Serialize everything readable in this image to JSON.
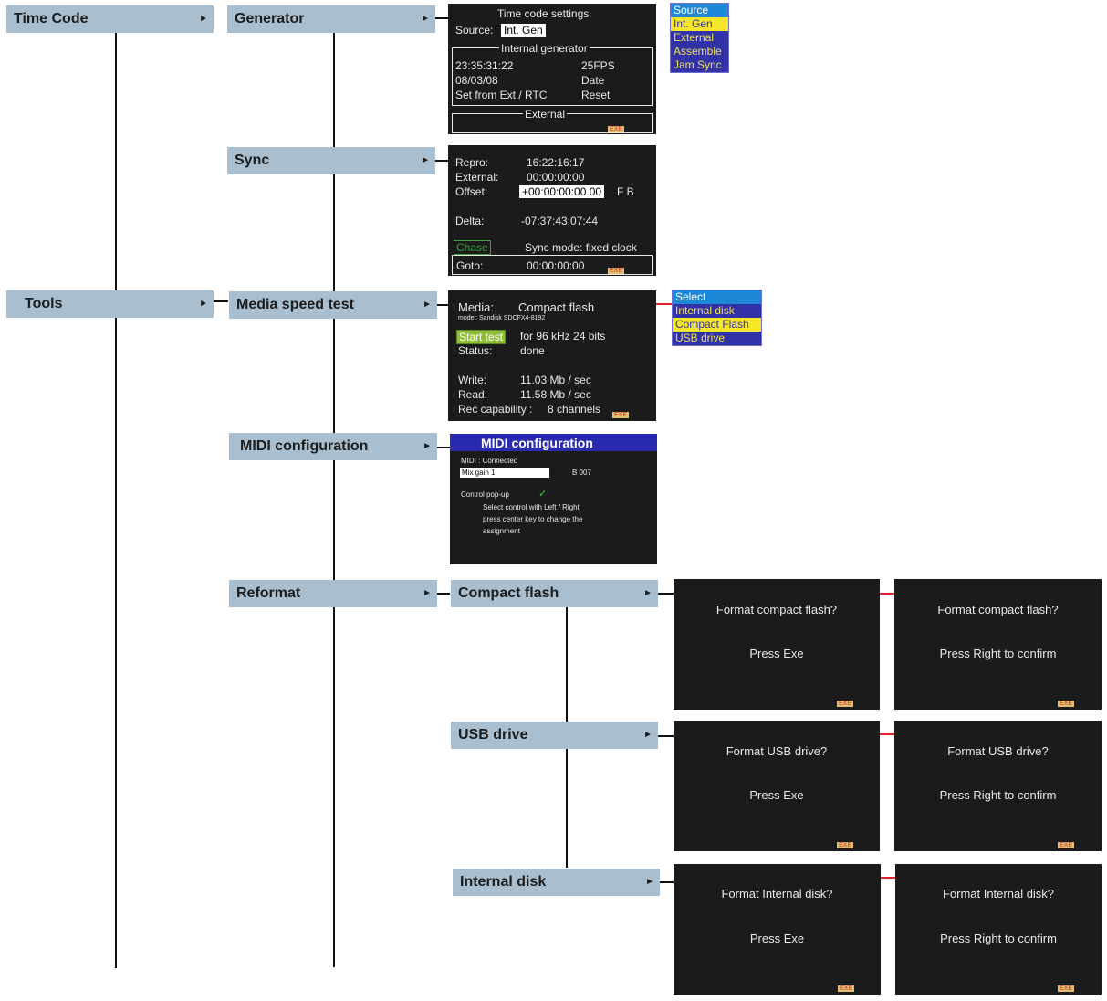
{
  "menus": {
    "time_code": "Time Code",
    "tools": "Tools",
    "generator": "Generator",
    "sync": "Sync",
    "media_speed_test": "Media speed test",
    "midi_configuration": "MIDI configuration",
    "reformat": "Reformat",
    "compact_flash": "Compact flash",
    "usb_drive": "USB drive",
    "internal_disk": "Internal disk",
    "arrow": "►"
  },
  "generator_screen": {
    "title": "Time code settings",
    "source_label": "Source:",
    "source_value": "Int. Gen",
    "internal_generator": "Internal generator",
    "time": "23:35:31:22",
    "fps": "25FPS",
    "date": "08/03/08",
    "date_label": "Date",
    "set_from": "Set from Ext / RTC",
    "reset": "Reset",
    "external": "External",
    "exe": "EXE"
  },
  "source_popup": [
    "Source",
    "Int. Gen",
    "External",
    "Assemble",
    "Jam Sync"
  ],
  "sync_screen": {
    "repro_label": "Repro:",
    "repro_value": "16:22:16:17",
    "external_label": "External:",
    "external_value": "00:00:00:00",
    "offset_label": "Offset:",
    "offset_value": "+00:00:00:00.00",
    "offset_fb": "F B",
    "delta_label": "Delta:",
    "delta_value": "-07:37:43:07:44",
    "chase": "Chase",
    "sync_mode": "Sync mode: fixed clock",
    "goto_label": "Goto:",
    "goto_value": "00:00:00:00",
    "exe": "EXE"
  },
  "media_screen": {
    "media_label": "Media:",
    "media_value": "Compact flash",
    "model": "model: Sandisk SDCFX4-8192",
    "start_test": "Start test",
    "start_desc": "for 96 kHz 24 bits",
    "status_label": "Status:",
    "status_value": "done",
    "write_label": "Write:",
    "write_value": "11.03 Mb / sec",
    "read_label": "Read:",
    "read_value": "11.58 Mb / sec",
    "rec_label": "Rec capability :",
    "rec_value": "8 channels",
    "exe": "EXE"
  },
  "select_popup": [
    "Select",
    "Internal disk",
    "Compact Flash",
    "USB drive"
  ],
  "midi_screen": {
    "title": "MIDI configuration",
    "connected": "MIDI : Connected",
    "field": "Mix gain 1",
    "code": "B 007",
    "control_popup": "Control pop-up",
    "check": "✓",
    "hint1": "Select control with Left / Right",
    "hint2": "press center key to change the",
    "hint3": "assignment"
  },
  "confirm_screens": [
    {
      "q": "Format compact flash?",
      "a": "Press Exe",
      "exe": "EXE"
    },
    {
      "q": "Format compact flash?",
      "a": "Press Right to confirm",
      "exe": "EXE"
    },
    {
      "q": "Format USB drive?",
      "a": "Press Exe",
      "exe": "EXE"
    },
    {
      "q": "Format USB drive?",
      "a": "Press Right to confirm",
      "exe": "EXE"
    },
    {
      "q": "Format Internal disk?",
      "a": "Press Exe",
      "exe": "EXE"
    },
    {
      "q": "Format Internal disk?",
      "a": "Press Right to confirm",
      "exe": "EXE"
    }
  ]
}
